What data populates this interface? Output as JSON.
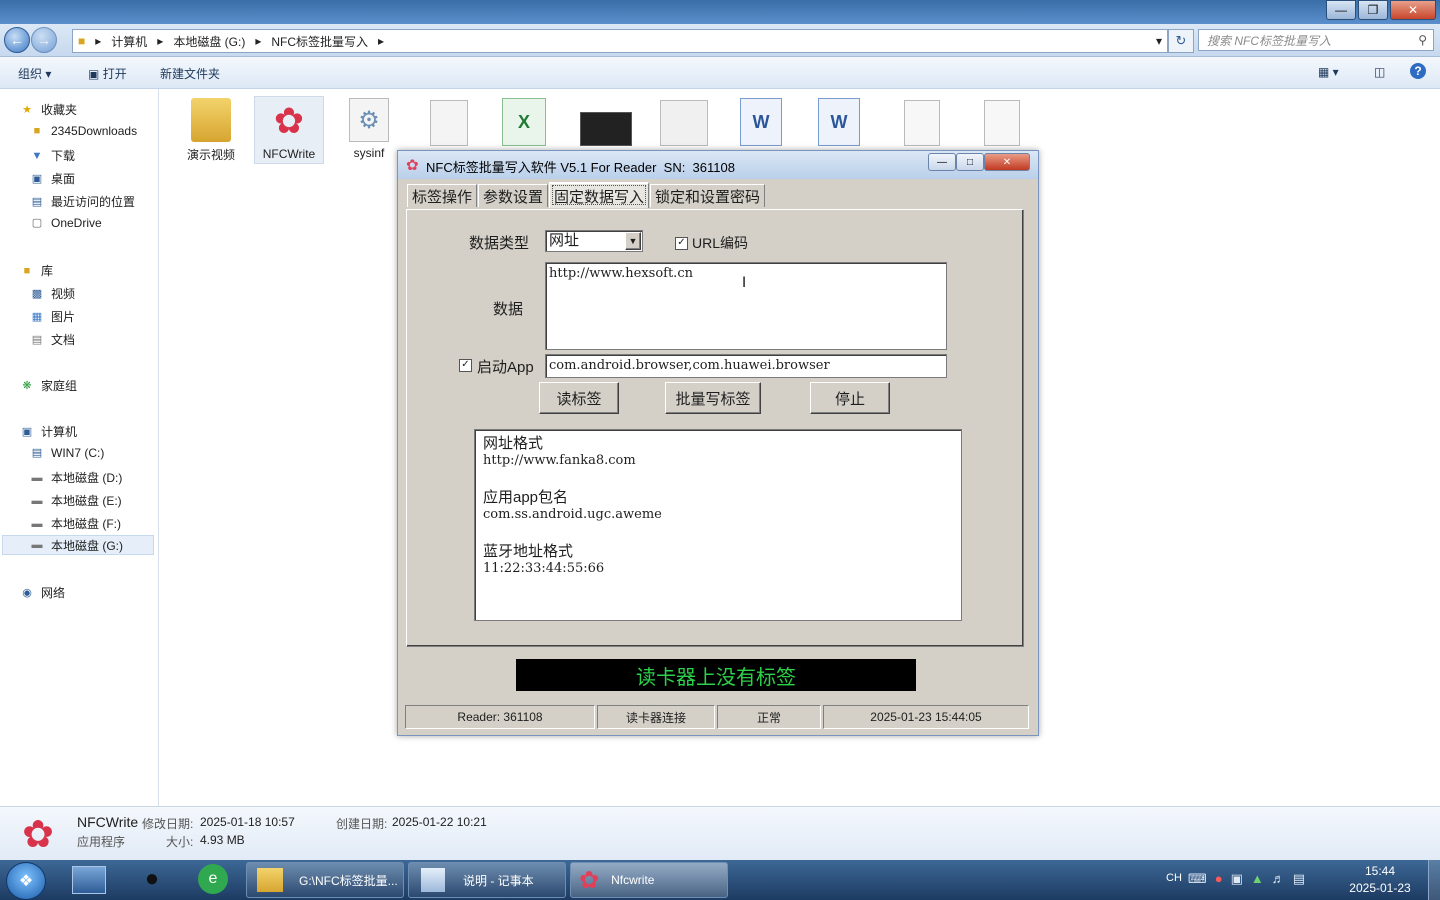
{
  "explorer": {
    "address": {
      "segments": [
        "计算机",
        "本地磁盘 (G:)",
        "NFC标签批量写入"
      ]
    },
    "search_placeholder": "搜索 NFC标签批量写入",
    "toolbar": {
      "organize": "组织",
      "open": "打开",
      "new_folder": "新建文件夹"
    },
    "sidebar": {
      "favorites": {
        "title": "收藏夹",
        "items": [
          "2345Downloads",
          "下载",
          "桌面",
          "最近访问的位置",
          "OneDrive"
        ]
      },
      "libraries": {
        "title": "库",
        "items": [
          "视频",
          "图片",
          "文档"
        ]
      },
      "homegroup": "家庭组",
      "computer": {
        "title": "计算机",
        "items": [
          "WIN7 (C:)",
          "本地磁盘 (D:)",
          "本地磁盘 (E:)",
          "本地磁盘 (F:)",
          "本地磁盘 (G:)"
        ]
      },
      "network": "网络"
    },
    "files": [
      {
        "name": "演示视频",
        "icon": "folder-icon"
      },
      {
        "name": "NFCWrite",
        "icon": "app-flower-icon"
      },
      {
        "name": "sysinf",
        "icon": "settings-file-icon"
      }
    ],
    "details": {
      "name": "NFCWrite",
      "type": "应用程序",
      "modified_label": "修改日期:",
      "modified": "2025-01-18 10:57",
      "created_label": "创建日期:",
      "created": "2025-01-22 10:21",
      "size_label": "大小:",
      "size": "4.93 MB"
    }
  },
  "dialog": {
    "title": "NFC标签批量写入软件 V5.1 For Reader  SN:  361108",
    "tabs": [
      "标签操作",
      "参数设置",
      "固定数据写入",
      "锁定和设置密码"
    ],
    "active_tab": 2,
    "form": {
      "data_type_label": "数据类型",
      "data_type_value": "网址",
      "url_encode_label": "URL编码",
      "url_encode_checked": true,
      "data_label": "数据",
      "data_value": "http://www.hexsoft.cn",
      "launch_app_label": "启动App",
      "launch_app_checked": true,
      "launch_app_value": "com.android.browser,com.huawei.browser"
    },
    "buttons": {
      "read": "读标签",
      "batch_write": "批量写标签",
      "stop": "停止"
    },
    "info": [
      {
        "heading": "网址格式",
        "example": "http://www.fanka8.com"
      },
      {
        "heading": "应用app包名",
        "example": "com.ss.android.ugc.aweme"
      },
      {
        "heading": "蓝牙地址格式",
        "example": "11:22:33:44:55:66"
      }
    ],
    "status_message": "读卡器上没有标签",
    "status_message_color": "#2bd14a",
    "statusbar": [
      "Reader: 361108",
      "读卡器连接",
      "正常",
      "2025-01-23 15:44:05"
    ]
  },
  "taskbar": {
    "tasks": [
      "G:\\NFC标签批量...",
      "说明 - 记事本",
      "Nfcwrite"
    ],
    "tray": {
      "lang": "CH",
      "time": "15:44",
      "date": "2025-01-23"
    }
  }
}
